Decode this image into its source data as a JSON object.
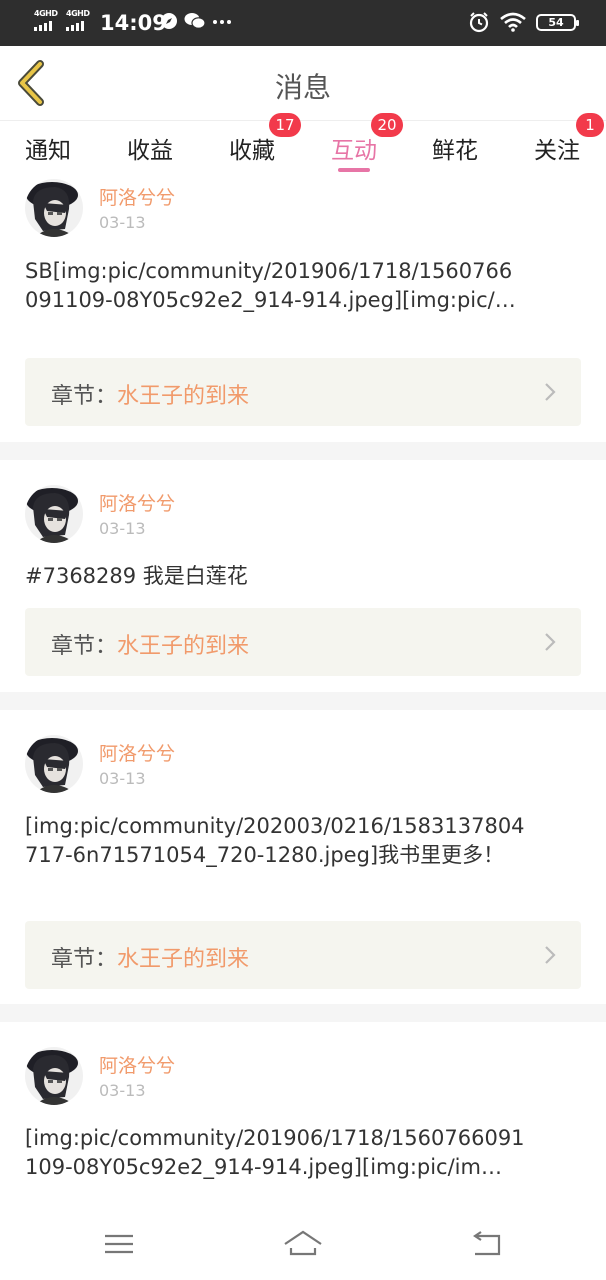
{
  "status_bar": {
    "network1": "4GHD",
    "network2": "4GHD",
    "time": "14:09",
    "battery": "54"
  },
  "header": {
    "title": "消息"
  },
  "tabs": [
    {
      "label": "通知",
      "badge": ""
    },
    {
      "label": "收益",
      "badge": ""
    },
    {
      "label": "收藏",
      "badge": "17"
    },
    {
      "label": "互动",
      "badge": "20",
      "active": true
    },
    {
      "label": "鲜花",
      "badge": ""
    },
    {
      "label": "关注",
      "badge": "1"
    }
  ],
  "posts": [
    {
      "username": "阿洛兮兮",
      "date": "03-13",
      "content": "SB[img:pic/community/201906/1718/1560766091109-08Y05c92e2_914-914.jpeg][img:pic/…",
      "chapter_label": "章节：",
      "chapter_title": "水王子的到来"
    },
    {
      "username": "阿洛兮兮",
      "date": "03-13",
      "content": "#7368289 我是白莲花",
      "chapter_label": "章节：",
      "chapter_title": "水王子的到来"
    },
    {
      "username": "阿洛兮兮",
      "date": "03-13",
      "content": "[img:pic/community/202003/0216/1583137804717-6n71571054_720-1280.jpeg]我书里更多！",
      "chapter_label": "章节：",
      "chapter_title": "水王子的到来"
    },
    {
      "username": "阿洛兮兮",
      "date": "03-13",
      "content": "[img:pic/community/201906/1718/1560766091109-08Y05c92e2_914-914.jpeg][img:pic/im…",
      "chapter_label": "章节：",
      "chapter_title": "水王子的到来"
    }
  ],
  "colors": {
    "accent": "#e775a6",
    "username": "#f19a6b",
    "badge": "#f23a4b",
    "back_arrow": "#e8c547"
  },
  "icons": {
    "back": "back-chevron-icon",
    "chapter_arrow": "chevron-right-icon",
    "nav_menu": "menu-icon",
    "nav_home": "home-icon",
    "nav_back": "return-icon"
  }
}
